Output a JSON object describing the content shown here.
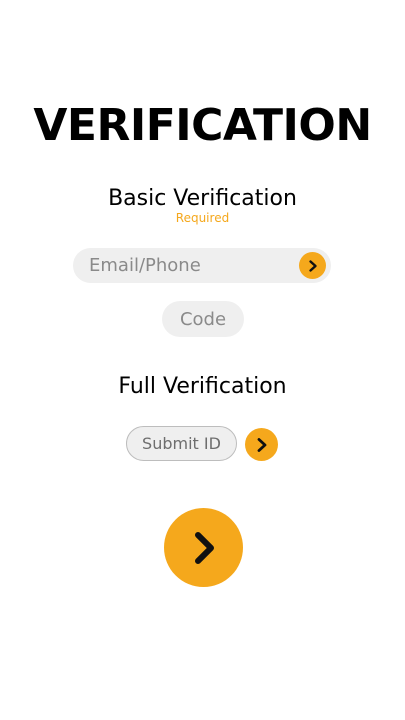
{
  "colors": {
    "accent": "#f5a81c",
    "required_text": "#f5a81c",
    "field_background": "#efefef",
    "placeholder_text": "#8a8a8a",
    "chevron": "#111111"
  },
  "header": {
    "title": "VERIFICATION"
  },
  "basic": {
    "title": "Basic Verification",
    "required_label": "Required",
    "email": {
      "placeholder": "Email/Phone",
      "value": "",
      "go_icon": "chevron-right-icon"
    },
    "code": {
      "placeholder": "Code",
      "value": ""
    }
  },
  "full": {
    "title": "Full Verification",
    "submit_label": "Submit ID",
    "go_icon": "chevron-right-icon"
  },
  "continue": {
    "icon": "chevron-right-icon"
  }
}
